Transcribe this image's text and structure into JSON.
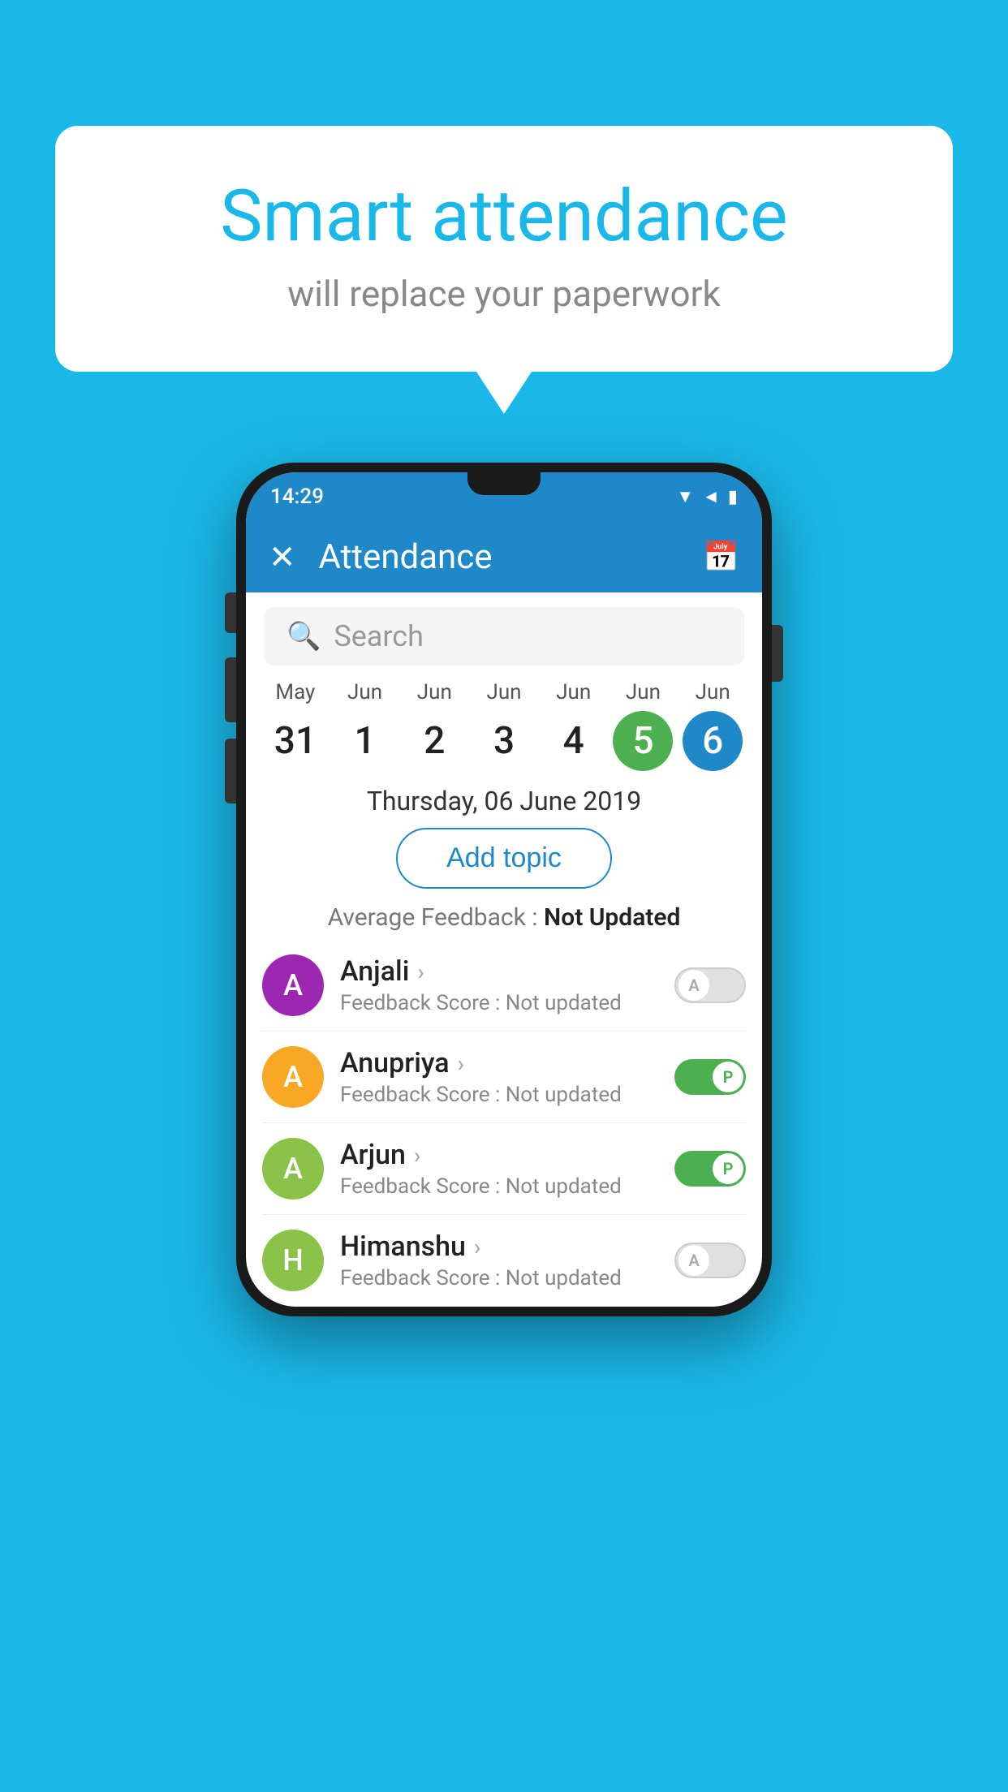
{
  "background_color": "#1ab8e8",
  "speech_bubble": {
    "title": "Smart attendance",
    "subtitle": "will replace your paperwork"
  },
  "phone": {
    "status_bar": {
      "time": "14:29",
      "icons": "▼◄▮"
    },
    "app_bar": {
      "close_label": "✕",
      "title": "Attendance",
      "calendar_icon": "📅"
    },
    "search": {
      "placeholder": "Search"
    },
    "calendar": {
      "days": [
        {
          "month": "May",
          "num": "31",
          "state": "normal"
        },
        {
          "month": "Jun",
          "num": "1",
          "state": "normal"
        },
        {
          "month": "Jun",
          "num": "2",
          "state": "normal"
        },
        {
          "month": "Jun",
          "num": "3",
          "state": "normal"
        },
        {
          "month": "Jun",
          "num": "4",
          "state": "normal"
        },
        {
          "month": "Jun",
          "num": "5",
          "state": "today"
        },
        {
          "month": "Jun",
          "num": "6",
          "state": "selected"
        }
      ]
    },
    "selected_date": "Thursday, 06 June 2019",
    "add_topic_label": "Add topic",
    "average_feedback_label": "Average Feedback : ",
    "average_feedback_value": "Not Updated",
    "students": [
      {
        "name": "Anjali",
        "initial": "A",
        "avatar_color": "#9c27b0",
        "feedback": "Not updated",
        "toggle": "off",
        "toggle_letter": "A"
      },
      {
        "name": "Anupriya",
        "initial": "A",
        "avatar_color": "#f9a825",
        "feedback": "Not updated",
        "toggle": "on",
        "toggle_letter": "P"
      },
      {
        "name": "Arjun",
        "initial": "A",
        "avatar_color": "#8bc34a",
        "feedback": "Not updated",
        "toggle": "on",
        "toggle_letter": "P"
      },
      {
        "name": "Himanshu",
        "initial": "H",
        "avatar_color": "#8bc34a",
        "feedback": "Not updated",
        "toggle": "off",
        "toggle_letter": "A"
      }
    ],
    "feedback_prefix": "Feedback Score : "
  }
}
